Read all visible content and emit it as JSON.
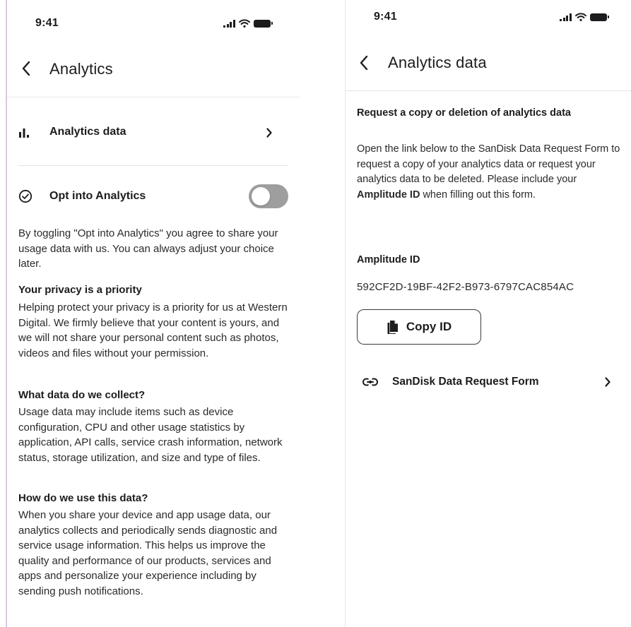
{
  "left_screen": {
    "status_time": "9:41",
    "header": {
      "back_label": "‹",
      "title": "Analytics"
    },
    "analytics_data_row": {
      "label": "Analytics data",
      "chevron": "›",
      "icon": "bar-chart-icon"
    },
    "opt_in": {
      "label": "Opt into Analytics",
      "icon": "check-circle-icon",
      "toggle_on": false
    },
    "intro": "By toggling \"Opt into Analytics\" you agree to share your usage data with us. You can always adjust your choice later.",
    "sections": [
      {
        "heading": "Your privacy is a priority",
        "body": "Helping protect your privacy is a priority for us at Western Digital. We firmly believe that your content is yours, and we will not share your personal content such as photos, videos and files without your permission."
      },
      {
        "heading": "What data do we collect?",
        "body": "Usage data may include items such as device configuration, CPU and other usage statistics by application, API calls, service crash information, network status, storage utilization, and size and type of files."
      },
      {
        "heading": "How do we use this data?",
        "body": "When you share your device and app usage data, our analytics collects and periodically sends diagnostic and service usage information. This helps us improve the quality and performance of our products, services and apps and personalize your experience including by sending push notifications."
      }
    ]
  },
  "right_screen": {
    "status_time": "9:41",
    "header": {
      "back_label": "‹",
      "title": "Analytics data"
    },
    "section_title": "Request a copy or deletion of analytics data",
    "description_part1": "Open the link below to the SanDisk Data Request Form to request a copy of your analytics data or request your analytics data to be deleted. Please include your ",
    "description_bold": "Amplitude ID",
    "description_part2": " when filling out this form.",
    "amplitude_label": "Amplitude ID",
    "amplitude_id": "592CF2D-19BF-42F2-B973-6797CAC854AC",
    "copy_button_label": "Copy ID",
    "form_link": {
      "label": "SanDisk Data Request Form",
      "chevron": "›",
      "icon": "link-icon"
    }
  },
  "colors": {
    "toggle_off": "#9e9e9e",
    "text": "#1c1c1e",
    "divider": "#e5e5e5",
    "left_edge": "#d9c9e8"
  }
}
